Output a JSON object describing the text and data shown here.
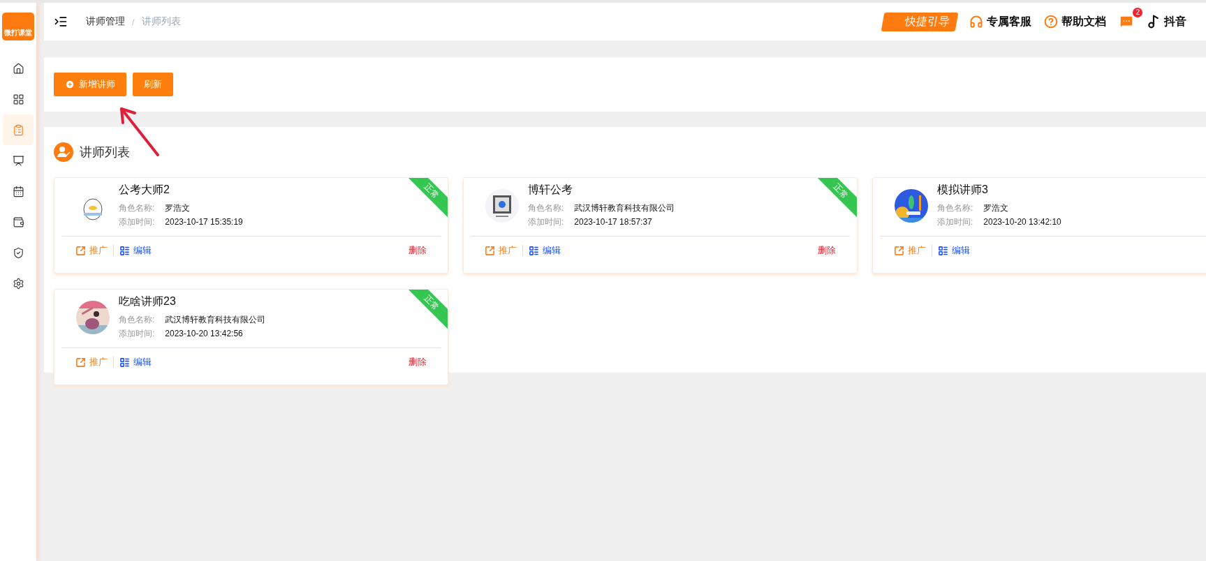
{
  "sidebar": {
    "logo_text": "微打课堂",
    "items": [
      {
        "selected": false
      },
      {
        "selected": false
      },
      {
        "selected": true
      },
      {
        "selected": false
      },
      {
        "selected": false
      },
      {
        "selected": false
      },
      {
        "selected": false
      },
      {
        "selected": false
      }
    ]
  },
  "header": {
    "breadcrumb": [
      "讲师管理",
      "讲师列表"
    ],
    "breadcrumb_separator": "/",
    "quick_guide": "快捷引导",
    "links": [
      {
        "kind": "service",
        "label": "专属客服"
      },
      {
        "kind": "help",
        "label": "帮助文档"
      }
    ],
    "messages_badge": "2",
    "douyin": "抖音"
  },
  "toolbar": {
    "buttons": [
      {
        "label": "新增讲师",
        "kind": "add"
      },
      {
        "label": "刷新",
        "kind": "plain"
      }
    ]
  },
  "list": {
    "title": "讲师列表",
    "cards": [
      {
        "name": "公考大师2",
        "role_label": "角色名称:",
        "role": "罗浩文",
        "time_label": "添加时间:",
        "time": "2023-10-17 15:35:19",
        "status": "正常",
        "promote": "推广",
        "edit": "编辑",
        "delete": "删除"
      },
      {
        "name": "博轩公考",
        "role_label": "角色名称:",
        "role": "武汉博轩教育科技有限公司",
        "time_label": "添加时间:",
        "time": "2023-10-17 18:57:37",
        "status": "正常",
        "promote": "推广",
        "edit": "编辑",
        "delete": "删除"
      },
      {
        "name": "模拟讲师3",
        "role_label": "角色名称:",
        "role": "罗浩文",
        "time_label": "添加时间:",
        "time": "2023-10-20 13:42:10",
        "promote": "推广",
        "edit": "编辑"
      },
      {
        "name": "吃啥讲师23",
        "role_label": "角色名称:",
        "role": "武汉博轩教育科技有限公司",
        "time_label": "添加时间:",
        "time": "2023-10-20 13:42:56",
        "status": "正常",
        "promote": "推广",
        "edit": "编辑",
        "delete": "删除"
      }
    ]
  }
}
